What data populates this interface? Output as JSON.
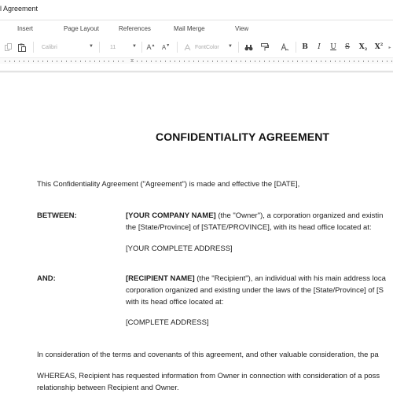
{
  "window": {
    "title": "l Agreement"
  },
  "menu": {
    "items": [
      "Insert",
      "Page Layout",
      "References",
      "Mail Merge",
      "View"
    ]
  },
  "toolbar": {
    "font_name": "Calibri",
    "font_size": "11",
    "font_color_label": "FontColor",
    "grow_font": "A",
    "shrink_font": "A",
    "bold": "B",
    "italic": "I",
    "underline": "U",
    "strikethrough": "S",
    "subscript": "X",
    "superscript": "X",
    "subscript_mark": "2",
    "superscript_mark": "2"
  },
  "document": {
    "title": "CONFIDENTIALITY AGREEMENT",
    "intro": "This Confidentiality Agreement (\"Agreement\") is made and effective the [DATE],",
    "between": {
      "label": "BETWEEN:",
      "party_name": "[YOUR COMPANY NAME]",
      "line1_rest": " (the \"Owner\"), a corporation organized and existin",
      "line2": "the [State/Province] of [STATE/PROVINCE], with its head office located at:",
      "address": "[YOUR COMPLETE ADDRESS]"
    },
    "and": {
      "label": "AND:",
      "party_name": "[RECIPIENT NAME]",
      "line1_rest": " (the \"Recipient\"), an individual with his main address loca",
      "line2": "corporation organized and existing under the laws of the [State/Province] of [S",
      "line3": "with its head office located at:",
      "address": "[COMPLETE ADDRESS]"
    },
    "consideration": "In consideration of the terms and covenants of this agreement, and other valuable consideration, the pa",
    "whereas_line1": "WHEREAS, Recipient has requested information from Owner in connection with consideration of a poss",
    "whereas_line2": "relationship between Recipient and Owner."
  }
}
